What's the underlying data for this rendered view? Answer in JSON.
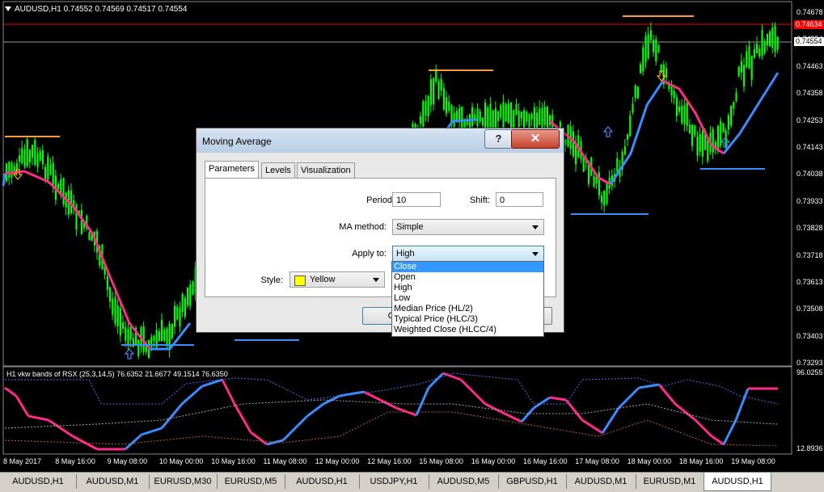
{
  "chart": {
    "symbol_info": "AUDUSD,H1  0.74552 0.74569 0.74517 0.74554",
    "indicator_label": "H1 vkw bands of RSX (25,3,14,5) 76.6352 21.6677 49.1514 76.6350",
    "price_ticks": [
      "0.74678",
      "0.74554",
      "0.74463",
      "0.74358",
      "0.74253",
      "0.74143",
      "0.74038",
      "0.73933",
      "0.73828",
      "0.73718",
      "0.73613",
      "0.73508",
      "0.73403",
      "0.73293"
    ],
    "price_tag_red": "0.74634",
    "price_tag_current": "0.74554",
    "ind_ticks": [
      "96.0255",
      "12.8936"
    ],
    "time_ticks": [
      "8 May 2017",
      "8 May 16:00",
      "9 May 08:00",
      "10 May 00:00",
      "10 May 16:00",
      "11 May 08:00",
      "12 May 00:00",
      "12 May 16:00",
      "15 May 08:00",
      "16 May 00:00",
      "16 May 16:00",
      "17 May 08:00",
      "18 May 00:00",
      "18 May 16:00",
      "19 May 08:00"
    ],
    "colors": {
      "candle": "#00ff00",
      "ma_pink": "#ff2a8a",
      "ma_blue": "#3a8cff",
      "support": "#3a8cff",
      "resistance": "#ff9a40",
      "red_line": "#ff0000"
    }
  },
  "tabs": [
    "AUDUSD,H1",
    "AUDUSD,M1",
    "EURUSD,M30",
    "EURUSD,M5",
    "AUDUSD,H1",
    "USDJPY,H1",
    "AUDUSD,M5",
    "GBPUSD,H1",
    "AUDUSD,M1",
    "EURUSD,M1",
    "AUDUSD,H1"
  ],
  "active_tab_index": 10,
  "dialog": {
    "title": "Moving Average",
    "help_label": "?",
    "close_label": "✕",
    "tabs": [
      "Parameters",
      "Levels",
      "Visualization"
    ],
    "period_label": "Period:",
    "period_value": "10",
    "shift_label": "Shift:",
    "shift_value": "0",
    "method_label": "MA method:",
    "method_value": "Simple",
    "apply_label": "Apply to:",
    "apply_value": "High",
    "style_label": "Style:",
    "style_value": "Yellow",
    "style_color": "#ffff00",
    "ok_label": "O",
    "dropdown_options": [
      "Close",
      "Open",
      "High",
      "Low",
      "Median Price (HL/2)",
      "Typical Price (HLC/3)",
      "Weighted Close (HLCC/4)"
    ],
    "dropdown_selected": 0
  }
}
